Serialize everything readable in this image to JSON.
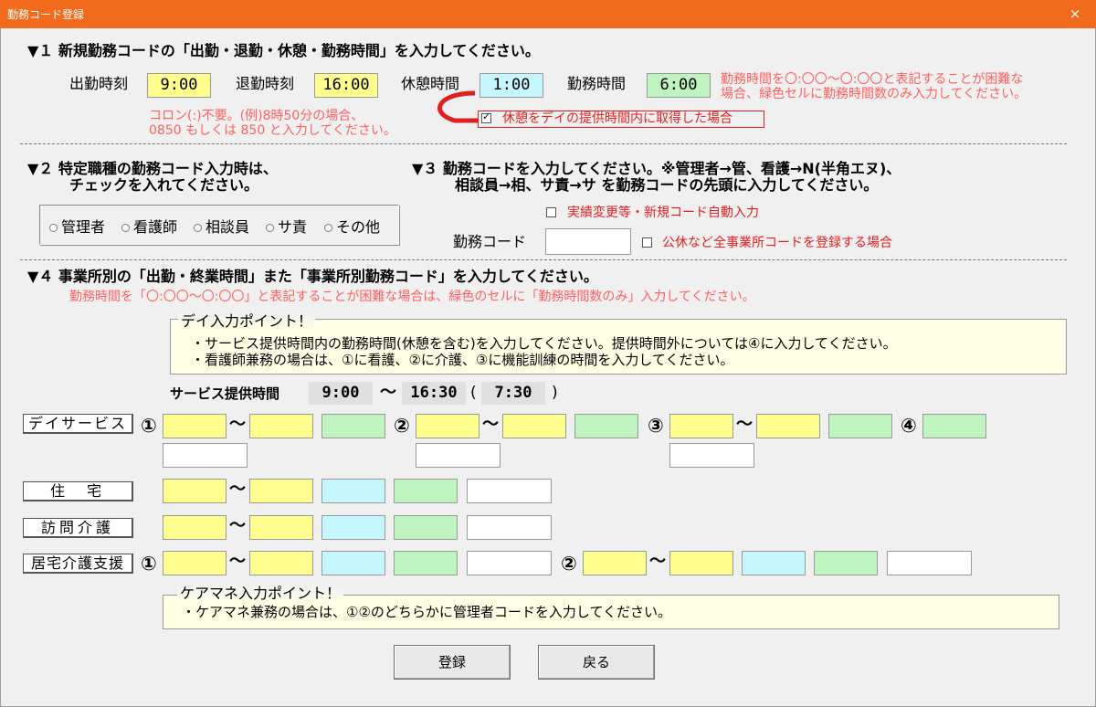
{
  "window": {
    "title": "勤務コード登録",
    "close": "×"
  },
  "sec1": {
    "heading": "▼１ 新規勤務コードの「出勤・退勤・休憩・勤務時間」を入力してください。",
    "start_label": "出勤時刻",
    "start_value": "9:00",
    "end_label": "退勤時刻",
    "end_value": "16:00",
    "break_label": "休憩時間",
    "break_value": "1:00",
    "work_label": "勤務時間",
    "work_value": "6:00",
    "work_note_1": "勤務時間を〇:〇〇～〇:〇〇と表記することが困難な",
    "work_note_2": "場合、緑色セルに勤務時間数のみ入力してください。",
    "colon_note_1": "コロン(:)不要。(例)8時50分の場合、",
    "colon_note_2": "0850 もしくは 850 と入力してください。",
    "break_check_label": "休憩をデイの提供時間内に取得した場合"
  },
  "sec2": {
    "heading_1": "▼２ 特定職種の勤務コード入力時は、",
    "heading_2": "チェックを入れてください。",
    "options": [
      "管理者",
      "看護師",
      "相談員",
      "サ責",
      "その他"
    ]
  },
  "sec3": {
    "heading_1": "▼３ 勤務コードを入力してください。※管理者→管、看護→N(半角エヌ)、",
    "heading_2": "相談員→相、サ責→サ を勤務コードの先頭に入力してください。",
    "auto_label": "実績変更等・新規コード自動入力",
    "code_label": "勤務コード",
    "all_label": "公休など全事業所コードを登録する場合"
  },
  "sec4": {
    "heading": "▼４ 事業所別の「出勤・終業時間」また「事業所別勤務コード」を入力してください。",
    "note": "勤務時間を「〇:〇〇～〇:〇〇」と表記することが困難な場合は、緑色のセルに「勤務時間数のみ」入力してください。",
    "day_point_title": "デイ入力ポイント！",
    "day_point_1": "・サービス提供時間内の勤務時間(休憩を含む)を入力してください。提供時間外については④に入力してください。",
    "day_point_2": "・看護師兼務の場合は、①に看護、②に介護、③に機能訓練の時間を入力してください。",
    "service_label": "サービス提供時間",
    "service_start": "9:00",
    "tilde": "～",
    "service_end": "16:30",
    "paren_open": "(",
    "service_hours": "7:30",
    "paren_close": ")",
    "rows": {
      "day": "デイサービス",
      "house": "住　宅",
      "visit": "訪問介護",
      "care": "居宅介護支援"
    },
    "circled": [
      "①",
      "②",
      "③",
      "④"
    ],
    "cm_point_title": "ケアマネ入力ポイント！",
    "cm_point_1": "・ケアマネ兼務の場合は、①②のどちらかに管理者コードを入力してください。"
  },
  "buttons": {
    "register": "登録",
    "back": "戻る"
  },
  "colors": {
    "titlebar": "#f26b1c",
    "yellow": "#ffff8f",
    "green": "#bff3bf",
    "cyan": "#c6f6ff",
    "note_red": "#ff6060"
  }
}
